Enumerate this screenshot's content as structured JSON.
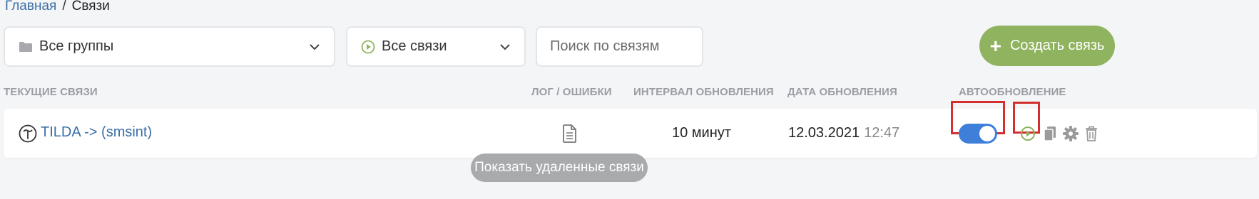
{
  "breadcrumb": {
    "home": "Главная",
    "separator": "/",
    "current": "Связи"
  },
  "filters": {
    "groups": {
      "label": "Все группы",
      "icon": "folder-icon"
    },
    "links": {
      "label": "Все связи",
      "icon": "play-circle-icon"
    },
    "search": {
      "placeholder": "Поиск по связям",
      "value": ""
    }
  },
  "create_button": {
    "label": "Создать связь",
    "icon": "plus-icon"
  },
  "columns": {
    "current": "ТЕКУЩИЕ СВЯЗИ",
    "log": "ЛОГ / ОШИБКИ",
    "interval": "ИНТЕРВАЛ ОБНОВЛЕНИЯ",
    "date": "ДАТА ОБНОВЛЕНИЯ",
    "auto": "АВТООБНОВЛЕНИЕ"
  },
  "rows": [
    {
      "name": "TILDA -> (smsint)",
      "interval": "10 минут",
      "date": "12.03.2021",
      "time": "12:47",
      "auto_update": true
    }
  ],
  "show_deleted_label": "Показать удаленные связи",
  "colors": {
    "accent_green": "#8fb35e",
    "link_blue": "#3a6ea5",
    "toggle_blue": "#3d7fd9",
    "highlight_red": "#d32f2f"
  }
}
